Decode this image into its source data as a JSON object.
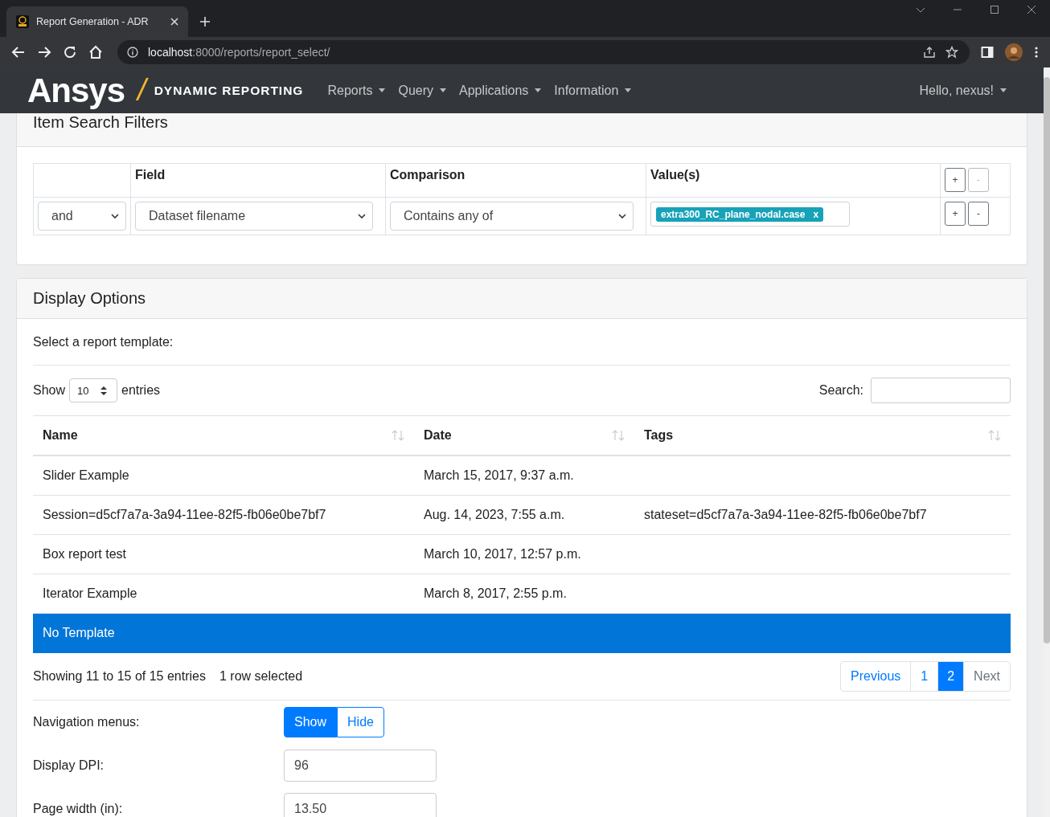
{
  "browser": {
    "tab_title": "Report Generation - ADR",
    "url_host": "localhost",
    "url_path": ":8000/reports/report_select/"
  },
  "navbar": {
    "brand": "Ansys",
    "slash": "/",
    "product": "DYNAMIC REPORTING",
    "menus": [
      "Reports",
      "Query",
      "Applications",
      "Information"
    ],
    "user": "Hello, nexus!"
  },
  "filters": {
    "title": "Item Search Filters",
    "columns": [
      "Field",
      "Comparison",
      "Value(s)"
    ],
    "header_buttons": [
      {
        "label": "+",
        "disabled": false
      },
      {
        "label": "-",
        "disabled": true
      }
    ],
    "rows": [
      {
        "conjunction": "and",
        "field": "Dataset filename",
        "comparison": "Contains any of",
        "tags": [
          "extra300_RC_plane_nodal.case"
        ],
        "tag_remove": "x",
        "buttons": [
          {
            "label": "+",
            "disabled": false
          },
          {
            "label": "-",
            "disabled": false
          }
        ]
      }
    ]
  },
  "display": {
    "title": "Display Options",
    "template_label": "Select a report template:",
    "show_label": "Show",
    "entries_value": "10",
    "entries_label": "entries",
    "search_label": "Search:",
    "columns": [
      "Name",
      "Date",
      "Tags"
    ],
    "rows": [
      {
        "name": "Slider Example",
        "date": "March 15, 2017, 9:37 a.m.",
        "tags": "",
        "selected": false
      },
      {
        "name": "Session=d5cf7a7a-3a94-11ee-82f5-fb06e0be7bf7",
        "date": "Aug. 14, 2023, 7:55 a.m.",
        "tags": "stateset=d5cf7a7a-3a94-11ee-82f5-fb06e0be7bf7",
        "selected": false
      },
      {
        "name": "Box report test",
        "date": "March 10, 2017, 12:57 p.m.",
        "tags": "",
        "selected": false
      },
      {
        "name": "Iterator Example",
        "date": "March 8, 2017, 2:55 p.m.",
        "tags": "",
        "selected": false
      },
      {
        "name": "No Template",
        "date": "",
        "tags": "",
        "selected": true
      }
    ],
    "info": "Showing 11 to 15 of 15 entries",
    "selected_info": "1 row selected",
    "pagination": [
      {
        "label": "Previous",
        "selected": false,
        "disabled": false
      },
      {
        "label": "1",
        "selected": false,
        "disabled": false
      },
      {
        "label": "2",
        "selected": true,
        "disabled": false
      },
      {
        "label": "Next",
        "selected": false,
        "disabled": true
      }
    ],
    "nav_menus": {
      "label": "Navigation menus:",
      "options": [
        {
          "label": "Show",
          "selected": true
        },
        {
          "label": "Hide",
          "selected": false
        }
      ]
    },
    "fields": [
      {
        "label": "Display DPI:",
        "value": "96"
      },
      {
        "label": "Page width (in):",
        "value": "13.50"
      }
    ]
  }
}
